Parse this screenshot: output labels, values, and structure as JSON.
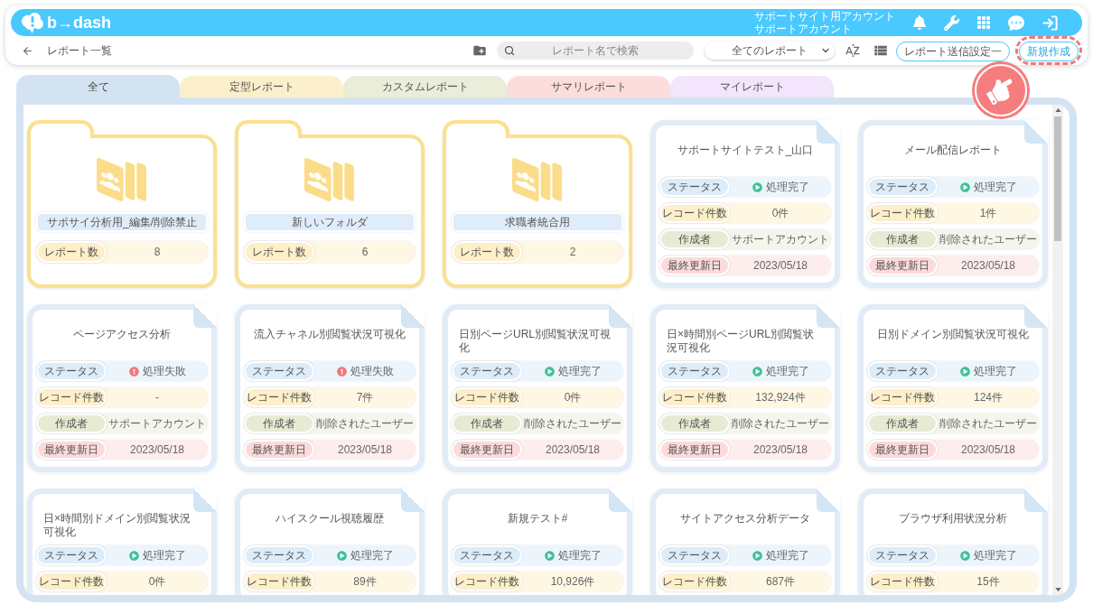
{
  "header": {
    "logo": "b→dash",
    "account": [
      "サポートサイト用アカウント",
      "サポートアカウント"
    ]
  },
  "toolbar": {
    "title": "レポート一覧",
    "search": {
      "placeholder": "レポート名で検索"
    },
    "filter": {
      "value": "全てのレポート"
    },
    "buttons": [
      {
        "label": "レポート送信設定一",
        "kind": "outline",
        "highlighted": false
      },
      {
        "label": "新規作成",
        "kind": "primary",
        "highlighted": true
      }
    ]
  },
  "tabs": [
    {
      "label": "全て",
      "selected": true,
      "color": "#d3e3f1"
    },
    {
      "label": "定型レポート",
      "selected": false,
      "color": "#fcf0cc"
    },
    {
      "label": "カスタムレポート",
      "selected": false,
      "color": "#e9edd9"
    },
    {
      "label": "サマリレポート",
      "selected": false,
      "color": "#fddcdc"
    },
    {
      "label": "マイレポート",
      "selected": false,
      "color": "#f3e5fb"
    }
  ],
  "cards": [
    {
      "kind": "folder",
      "name": "サポサイ分析用_編集/削除禁止",
      "count_label": "レポート数",
      "count": "8"
    },
    {
      "kind": "folder",
      "name": "新しいフォルダ",
      "count_label": "レポート数",
      "count": "6"
    },
    {
      "kind": "folder",
      "name": "求職者統合用",
      "count_label": "レポート数",
      "count": "2"
    },
    {
      "kind": "report",
      "title": "サポートサイトテスト_山口",
      "fields": [
        {
          "kind": "status",
          "label": "ステータス",
          "value": "処理完了",
          "error": false
        },
        {
          "kind": "records",
          "label": "レコード件数",
          "value": "0件"
        },
        {
          "kind": "author",
          "label": "作成者",
          "value": "サポートアカウント"
        },
        {
          "kind": "updated",
          "label": "最終更新日",
          "value": "2023/05/18"
        }
      ]
    },
    {
      "kind": "report",
      "title": "メール配信レポート",
      "fields": [
        {
          "kind": "status",
          "label": "ステータス",
          "value": "処理完了",
          "error": false
        },
        {
          "kind": "records",
          "label": "レコード件数",
          "value": "1件"
        },
        {
          "kind": "author",
          "label": "作成者",
          "value": "削除されたユーザー"
        },
        {
          "kind": "updated",
          "label": "最終更新日",
          "value": "2023/05/18"
        }
      ]
    },
    {
      "kind": "report",
      "title": "ページアクセス分析",
      "fields": [
        {
          "kind": "status",
          "label": "ステータス",
          "value": "処理失敗",
          "error": true
        },
        {
          "kind": "records",
          "label": "レコード件数",
          "value": "-"
        },
        {
          "kind": "author",
          "label": "作成者",
          "value": "サポートアカウント"
        },
        {
          "kind": "updated",
          "label": "最終更新日",
          "value": "2023/05/18"
        }
      ]
    },
    {
      "kind": "report",
      "title": "流入チャネル別閲覧状況可視化",
      "fields": [
        {
          "kind": "status",
          "label": "ステータス",
          "value": "処理失敗",
          "error": true
        },
        {
          "kind": "records",
          "label": "レコード件数",
          "value": "7件"
        },
        {
          "kind": "author",
          "label": "作成者",
          "value": "削除されたユーザー"
        },
        {
          "kind": "updated",
          "label": "最終更新日",
          "value": "2023/05/18"
        }
      ]
    },
    {
      "kind": "report",
      "title": "日別ページURL別閲覧状況可視化",
      "fields": [
        {
          "kind": "status",
          "label": "ステータス",
          "value": "処理完了",
          "error": false
        },
        {
          "kind": "records",
          "label": "レコード件数",
          "value": "0件"
        },
        {
          "kind": "author",
          "label": "作成者",
          "value": "削除されたユーザー"
        },
        {
          "kind": "updated",
          "label": "最終更新日",
          "value": "2023/05/18"
        }
      ]
    },
    {
      "kind": "report",
      "title": "日×時間別ページURL別閲覧状況可視化",
      "fields": [
        {
          "kind": "status",
          "label": "ステータス",
          "value": "処理完了",
          "error": false
        },
        {
          "kind": "records",
          "label": "レコード件数",
          "value": "132,924件"
        },
        {
          "kind": "author",
          "label": "作成者",
          "value": "削除されたユーザー"
        },
        {
          "kind": "updated",
          "label": "最終更新日",
          "value": "2023/05/18"
        }
      ]
    },
    {
      "kind": "report",
      "title": "日別ドメイン別閲覧状況可視化",
      "fields": [
        {
          "kind": "status",
          "label": "ステータス",
          "value": "処理完了",
          "error": false
        },
        {
          "kind": "records",
          "label": "レコード件数",
          "value": "124件"
        },
        {
          "kind": "author",
          "label": "作成者",
          "value": "削除されたユーザー"
        },
        {
          "kind": "updated",
          "label": "最終更新日",
          "value": "2023/05/18"
        }
      ]
    },
    {
      "kind": "report",
      "title": "日×時間別ドメイン別閲覧状況可視化",
      "fields": [
        {
          "kind": "status",
          "label": "ステータス",
          "value": "処理完了",
          "error": false
        },
        {
          "kind": "records",
          "label": "レコード件数",
          "value": "0件"
        }
      ]
    },
    {
      "kind": "report",
      "title": "ハイスクール視聴履歴",
      "fields": [
        {
          "kind": "status",
          "label": "ステータス",
          "value": "処理完了",
          "error": false
        },
        {
          "kind": "records",
          "label": "レコード件数",
          "value": "89件"
        }
      ]
    },
    {
      "kind": "report",
      "title": "新規テスト#",
      "fields": [
        {
          "kind": "status",
          "label": "ステータス",
          "value": "処理完了",
          "error": false
        },
        {
          "kind": "records",
          "label": "レコード件数",
          "value": "10,926件"
        }
      ]
    },
    {
      "kind": "report",
      "title": "サイトアクセス分析データ",
      "fields": [
        {
          "kind": "status",
          "label": "ステータス",
          "value": "処理完了",
          "error": false
        },
        {
          "kind": "records",
          "label": "レコード件数",
          "value": "687件"
        }
      ]
    },
    {
      "kind": "report",
      "title": "ブラウザ利用状況分析",
      "fields": [
        {
          "kind": "status",
          "label": "ステータス",
          "value": "処理完了",
          "error": false
        },
        {
          "kind": "records",
          "label": "レコード件数",
          "value": "15件"
        }
      ]
    }
  ]
}
